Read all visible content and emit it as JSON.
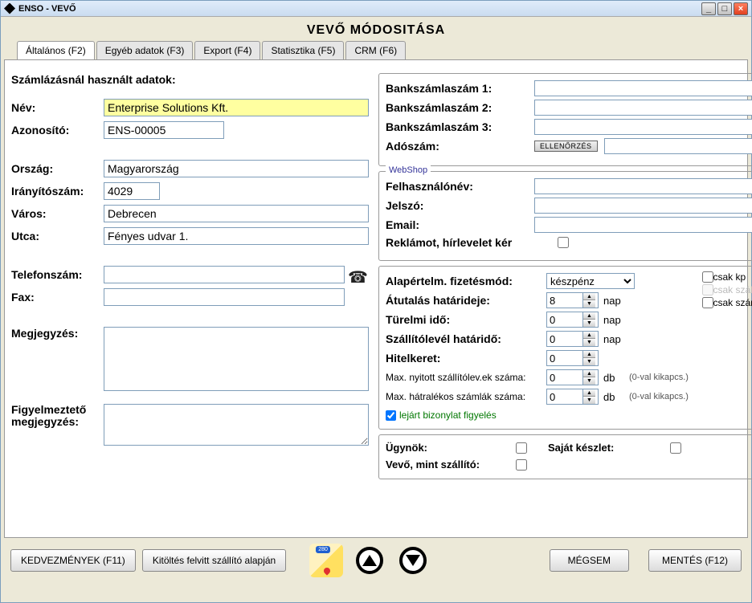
{
  "window": {
    "title": "ENSO - VEVŐ"
  },
  "main_title": "VEVŐ MÓDOSITÁSA",
  "tabs": [
    {
      "label": "Általános (F2)"
    },
    {
      "label": "Egyéb adatok (F3)"
    },
    {
      "label": "Export (F4)"
    },
    {
      "label": "Statisztika (F5)"
    },
    {
      "label": "CRM (F6)"
    }
  ],
  "left": {
    "section_title": "Számlázásnál használt adatok:",
    "name_label": "Név:",
    "name": "Enterprise Solutions Kft.",
    "id_label": "Azonosító:",
    "id": "ENS-00005",
    "country_label": "Ország:",
    "country": "Magyarország",
    "zip_label": "Irányítószám:",
    "zip": "4029",
    "city_label": "Város:",
    "city": "Debrecen",
    "street_label": "Utca:",
    "street": "Fényes udvar 1.",
    "phone_label": "Telefonszám:",
    "phone": "",
    "fax_label": "Fax:",
    "fax": "",
    "note_label": "Megjegyzés:",
    "note": "",
    "warn_label": "Figyelmeztető megjegyzés:",
    "warn": ""
  },
  "bank": {
    "acct1_label": "Bankszámlaszám 1:",
    "acct1": "",
    "acct2_label": "Bankszámlaszám 2:",
    "acct2": "",
    "acct3_label": "Bankszámlaszám 3:",
    "acct3": "",
    "tax_label": "Adószám:",
    "tax": "",
    "check_btn": "ELLENŐRZÉS"
  },
  "webshop": {
    "legend": "WebShop",
    "user_label": "Felhasználónév:",
    "user": "",
    "pwd_label": "Jelszó:",
    "pwd": "",
    "email_label": "Email:",
    "email": "",
    "newsletter_label": "Reklámot, hírlevelet kér"
  },
  "pay": {
    "default_label": "Alapértelm. fizetésmód:",
    "default": "készpénz",
    "transfer_label": "Átutalás határideje:",
    "transfer": "8",
    "transfer_unit": "nap",
    "grace_label": "Türelmi idő:",
    "grace": "0",
    "grace_unit": "nap",
    "slip_label": "Szállítólevél határidő:",
    "slip": "0",
    "slip_unit": "nap",
    "credit_label": "Hitelkeret:",
    "credit": "0",
    "open_slip_label": "Max. nyitott szállítólev.ek száma:",
    "open_slip": "0",
    "open_slip_unit": "db",
    "open_slip_note": "(0-val kikapcs.)",
    "arrears_label": "Max. hátralékos számlák száma:",
    "arrears": "0",
    "arrears_unit": "db",
    "arrears_note": "(0-val kikapcs.)",
    "expired_label": "lejárt bizonylat figyelés",
    "cash_only": "csak kp",
    "carrier_only": "csak szállító",
    "invoice_only": "csak számla"
  },
  "flags": {
    "agent_label": "Ügynök:",
    "own_stock_label": "Saját készlet:",
    "buyer_as_supplier_label": "Vevő, mint szállító:"
  },
  "buttons": {
    "discounts": "KEDVEZMÉNYEK (F11)",
    "fill": "Kitöltés felvitt szállító alapján",
    "cancel": "MÉGSEM",
    "save": "MENTÉS (F12)"
  }
}
